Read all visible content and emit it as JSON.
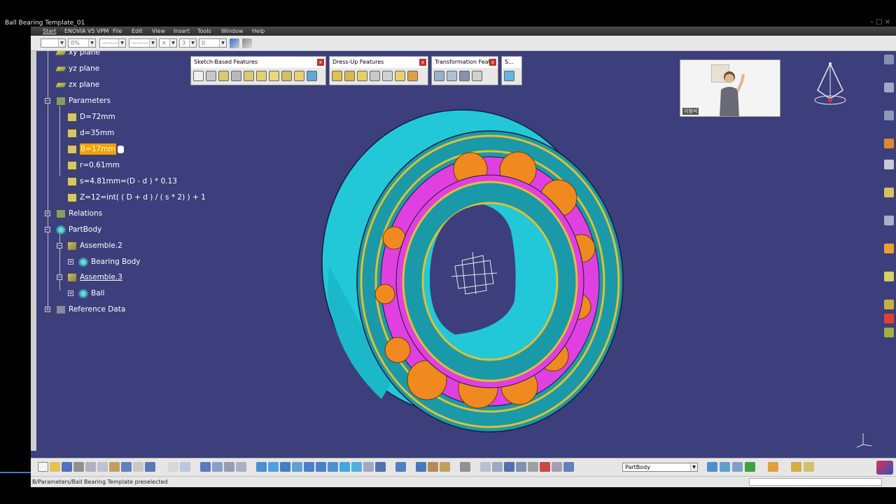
{
  "window": {
    "title": "Ball Bearing Template_01",
    "buttons": "– □ ×"
  },
  "menu": {
    "items": [
      "Start",
      "ENOVIA V5 VPM",
      "File",
      "Edit",
      "View",
      "Insert",
      "Tools",
      "Window",
      "Help"
    ]
  },
  "toolbar_top": {
    "opacity": "0%",
    "thickness": "3",
    "pattern": "0"
  },
  "tree": {
    "xy_plane": "xy plane",
    "yz_plane": "yz plane",
    "zx_plane": "zx plane",
    "parameters": "Parameters",
    "p_D": "D=72mm",
    "p_d": "d=35mm",
    "p_B": "B=17mm",
    "p_r": "r=0.61mm",
    "p_s": "s=4.81mm=(D - d ) * 0.13",
    "p_Z": "Z=12=int( ( D + d ) / ( s * 2) ) + 1",
    "relations": "Relations",
    "partbody": "PartBody",
    "assemble2": "Assemble.2",
    "bearing_body": "Bearing Body",
    "assemble3": "Assemble.3",
    "ball": "Ball",
    "reference_data": "Reference Data"
  },
  "floating_toolbars": {
    "sketch": "Sketch-Based Features",
    "dressup": "Dress-Up Features",
    "transform": "Transformation Feat...",
    "small": "S..."
  },
  "pip": {
    "name_tag": "이창석"
  },
  "part_selector": "PartBody",
  "status": "B/Parameters/Ball Bearing Template preselected",
  "colors": {
    "background": "#3c3f7c",
    "outer_ring": "#22c8d8",
    "ring_face": "#1a9aa8",
    "cage": "#e040e0",
    "balls": "#f08a20",
    "highlight": "#f5a000",
    "edge": "#e0c030"
  }
}
